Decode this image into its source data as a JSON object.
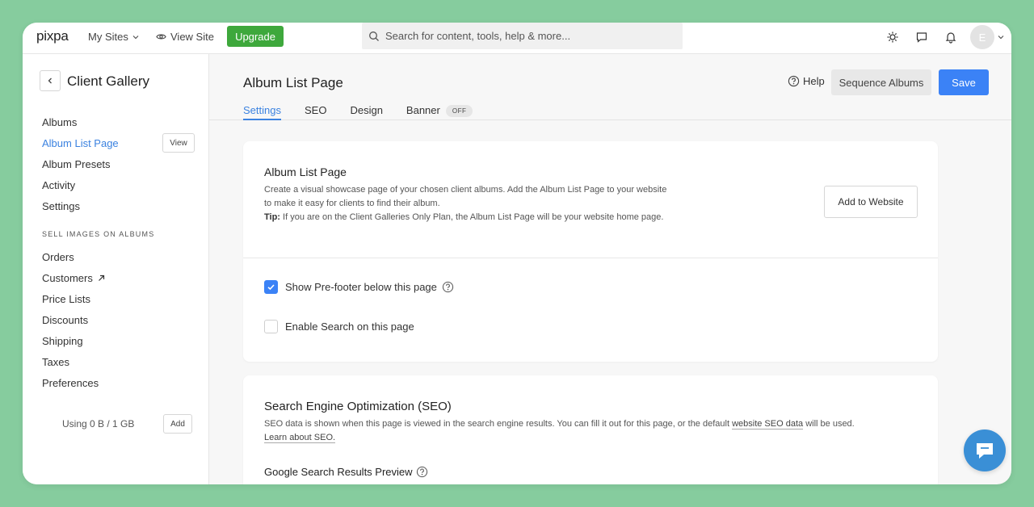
{
  "topbar": {
    "logo": "pixpa",
    "my_sites": "My Sites",
    "view_site": "View Site",
    "upgrade": "Upgrade",
    "search_placeholder": "Search for content, tools, help & more...",
    "avatar_initial": "E"
  },
  "sidebar": {
    "title": "Client Gallery",
    "items": [
      {
        "label": "Albums"
      },
      {
        "label": "Album List Page",
        "active": true
      },
      {
        "label": "Album Presets"
      },
      {
        "label": "Activity"
      },
      {
        "label": "Settings"
      }
    ],
    "view_label": "View",
    "section_label": "SELL IMAGES ON ALBUMS",
    "sell_items": [
      {
        "label": "Orders"
      },
      {
        "label": "Customers"
      },
      {
        "label": "Price Lists"
      },
      {
        "label": "Discounts"
      },
      {
        "label": "Shipping"
      },
      {
        "label": "Taxes"
      },
      {
        "label": "Preferences"
      }
    ],
    "storage": "Using 0 B / 1 GB",
    "add_label": "Add"
  },
  "header": {
    "title": "Album List Page",
    "help": "Help",
    "sequence": "Sequence Albums",
    "save": "Save",
    "tabs": [
      {
        "label": "Settings",
        "active": true
      },
      {
        "label": "SEO"
      },
      {
        "label": "Design"
      },
      {
        "label": "Banner",
        "badge": "OFF"
      }
    ]
  },
  "album_card": {
    "title": "Album List Page",
    "desc": "Create a visual showcase page of your chosen client albums. Add the Album List Page to your website to make it easy for clients to find their album.",
    "tip_label": "Tip:",
    "tip": "If you are on the Client Galleries Only Plan, the Album List Page will be your website home page.",
    "add_button": "Add to Website",
    "prefooter": {
      "label": "Show Pre-footer below this page",
      "checked": true
    },
    "search": {
      "label": "Enable Search on this page",
      "checked": false
    }
  },
  "seo_card": {
    "title": "Search Engine Optimization (SEO)",
    "desc_part1": "SEO data is shown when this page is viewed in the search engine results. You can fill it out for this page, or the default ",
    "link1": "website SEO data",
    "desc_part2": " will be used.",
    "link2": "Learn about SEO.",
    "preview_label": "Google Search Results Preview"
  },
  "colors": {
    "background": "#86cc9e",
    "accent": "#3b82f6",
    "upgrade": "#3ea83c",
    "chat": "#3a8fd6"
  }
}
